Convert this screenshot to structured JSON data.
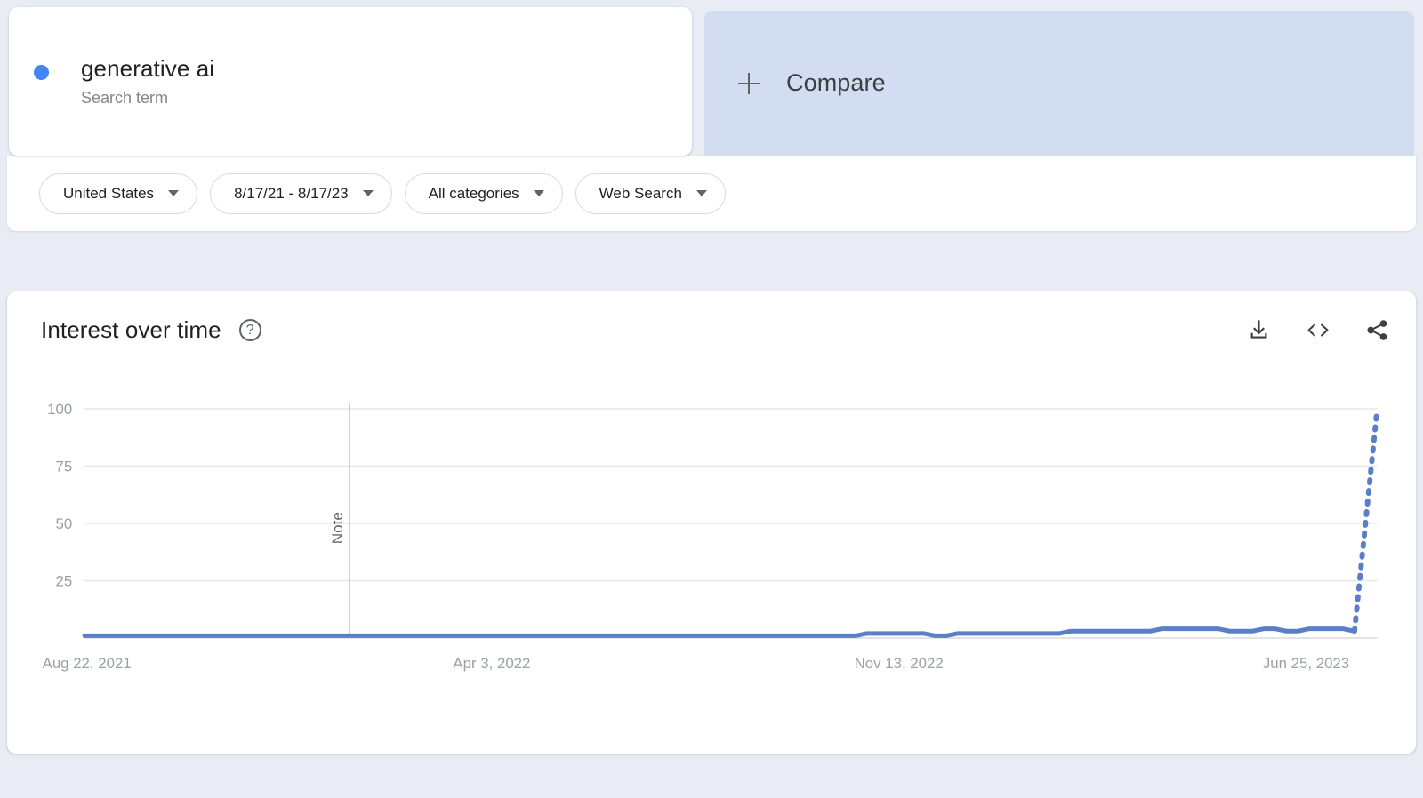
{
  "search_card": {
    "term": "generative ai",
    "type_label": "Search term",
    "dot_color": "#4285f4"
  },
  "compare": {
    "label": "Compare",
    "plus_icon": "plus-icon"
  },
  "filters": [
    {
      "label": "United States",
      "icon": "chevron-down-icon"
    },
    {
      "label": "8/17/21 - 8/17/23",
      "icon": "chevron-down-icon"
    },
    {
      "label": "All categories",
      "icon": "chevron-down-icon"
    },
    {
      "label": "Web Search",
      "icon": "chevron-down-icon"
    }
  ],
  "chart_card": {
    "title": "Interest over time",
    "help_icon": "help-icon",
    "help_glyph": "?",
    "actions": [
      {
        "name": "download-icon",
        "tooltip": "Download"
      },
      {
        "name": "embed-code-icon",
        "tooltip": "Embed"
      },
      {
        "name": "share-icon",
        "tooltip": "Share"
      }
    ]
  },
  "chart_data": {
    "type": "line",
    "title": "Interest over time",
    "xlabel": "",
    "ylabel": "",
    "ylim": [
      0,
      100
    ],
    "yticks": [
      100,
      75,
      50,
      25
    ],
    "xtick_labels": [
      "Aug 22, 2021",
      "Apr 3, 2022",
      "Nov 13, 2022",
      "Jun 25, 2023"
    ],
    "xtick_positions": [
      0,
      0.315,
      0.63,
      0.945
    ],
    "grid": true,
    "legend": null,
    "line_color": "#5b7fc7",
    "annotation": {
      "label": "Note",
      "x_fraction": 0.205,
      "orientation": "vertical"
    },
    "partial_data_dotted_tail": true,
    "series": [
      {
        "name": "generative ai",
        "values": [
          1,
          1,
          1,
          1,
          1,
          1,
          1,
          1,
          1,
          1,
          1,
          1,
          1,
          1,
          1,
          1,
          1,
          1,
          1,
          1,
          1,
          1,
          1,
          1,
          1,
          1,
          1,
          1,
          1,
          1,
          1,
          1,
          1,
          1,
          1,
          1,
          1,
          1,
          1,
          1,
          1,
          1,
          1,
          1,
          1,
          1,
          1,
          1,
          1,
          1,
          1,
          1,
          1,
          1,
          1,
          1,
          1,
          1,
          1,
          1,
          1,
          1,
          1,
          1,
          1,
          1,
          1,
          1,
          1,
          2,
          2,
          2,
          2,
          2,
          2,
          1,
          1,
          2,
          2,
          2,
          2,
          2,
          2,
          2,
          2,
          2,
          2,
          3,
          3,
          3,
          3,
          3,
          3,
          3,
          3,
          4,
          4,
          4,
          4,
          4,
          4,
          3,
          3,
          3,
          4,
          4,
          3,
          3,
          4,
          4,
          4,
          4,
          3,
          4,
          100
        ],
        "dotted_from_index": 112
      }
    ]
  }
}
